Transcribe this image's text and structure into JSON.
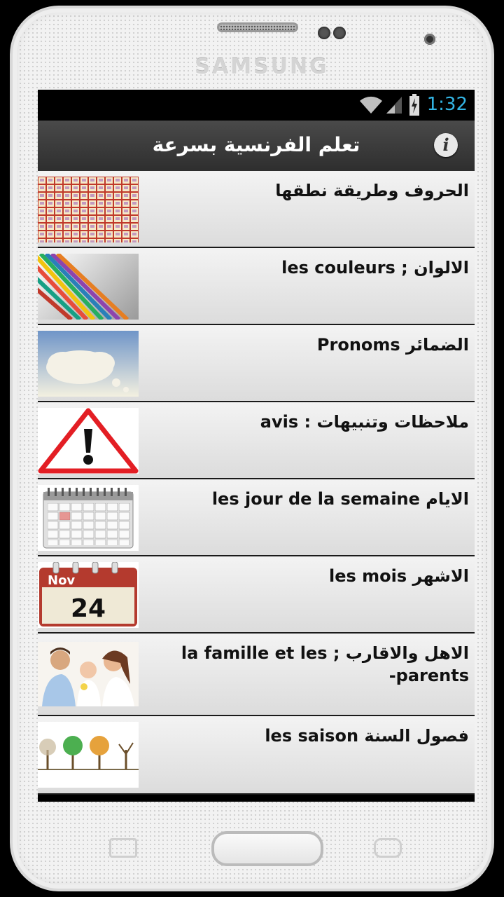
{
  "device": {
    "brand": "SAMSUNG"
  },
  "status_bar": {
    "time": "1:32",
    "wifi_icon": "wifi-icon",
    "signal_icon": "signal-icon",
    "battery_icon": "battery-charging-icon"
  },
  "action_bar": {
    "title": "تعلم الفرنسية بسرعة",
    "info_icon": "info-icon"
  },
  "colors": {
    "status_time": "#33b5e5",
    "action_bar": "#3a3a3a",
    "list_bg": "#e6e6e6"
  },
  "items": [
    {
      "label": "الحروف وطريقة نطقها",
      "thumb": "alphabet-grid"
    },
    {
      "label": "الالوان ; les couleurs",
      "thumb": "colored-pencils"
    },
    {
      "label": "الضمائر Pronoms",
      "thumb": "thought-cloud"
    },
    {
      "label": "ملاحظات وتنبيهات : avis",
      "thumb": "warning-sign"
    },
    {
      "label": "الايام les jour de la semaine",
      "thumb": "calendar-grid"
    },
    {
      "label": "الاشهر les mois",
      "thumb": "calendar-page"
    },
    {
      "label": "الاهل والاقارب ; la famille et les parents-",
      "thumb": "family-photo"
    },
    {
      "label": "فصول السنة les saison",
      "thumb": "seasons-trees"
    }
  ],
  "calendar_page": {
    "month": "Nov",
    "day": "24"
  }
}
